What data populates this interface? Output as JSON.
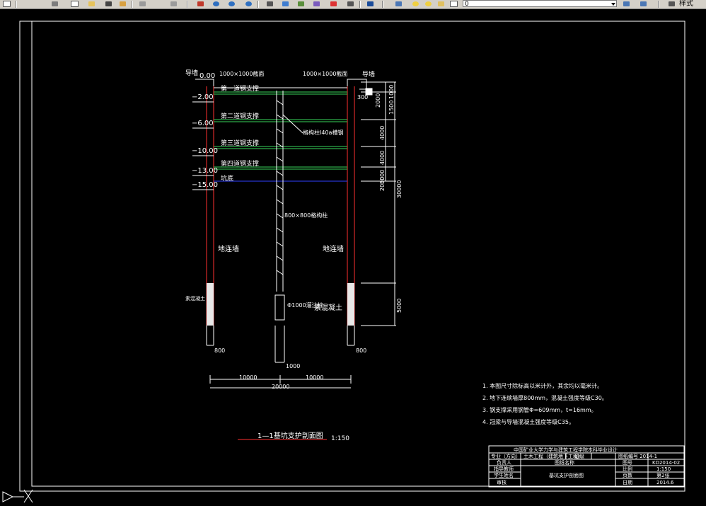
{
  "toolbar": {
    "layer_combo_value": "0",
    "style_label": "样式"
  },
  "drawing": {
    "elevations": [
      "0.00",
      "−2.00",
      "−6.00",
      "−10.00",
      "−13.00",
      "−15.00"
    ],
    "top_label_left": "导墙",
    "top_label_right": "导墙",
    "top_section_left": "1000×1000截面",
    "top_section_right": "1000×1000截面",
    "supports": [
      "第一道钢支撑",
      "第二道钢支撑",
      "第三道钢支撑",
      "第四道钢支撑"
    ],
    "bottom_label": "坑底",
    "column_beam_label": "格构柱I40a槽钢",
    "column_label": "800×800格构柱",
    "wall_left": "地连墙",
    "wall_right": "地连墙",
    "base_left": "素混凝土",
    "pile_label": "Φ1000灌注桩",
    "concrete_label": "素混凝土",
    "small_300": "300",
    "right_dims_top": [
      "1000",
      "2000",
      "1500",
      "4000",
      "4000",
      "3000",
      "2000"
    ],
    "right_dim_total": "30000",
    "right_dim_bottom": "5000",
    "bottom_dims": {
      "left_800": "800",
      "right_800": "800",
      "center_1000": "1000",
      "left_10000": "10000",
      "right_10000": "10000",
      "total": "20000"
    },
    "section_title": "1—1基坑支护剖面图",
    "section_scale": "1:150"
  },
  "notes": [
    "1. 本图尺寸除标高以米计外，其余均以毫米计。",
    "2. 地下连续墙厚800mm，混凝土强度等级C30。",
    "3. 钢支撑采用钢管Φ=609mm，t=16mm。",
    "4. 冠梁与导墙混凝土强度等级C35。"
  ],
  "title_block": {
    "header": "中国矿业大学力学与建筑工程学院本科毕业设计",
    "row1_left": "专业（方向）",
    "row1_mid": "土木工程（建筑地下工程）",
    "row1_c": "班级",
    "row1_right": "图纸编号 2014-1",
    "row2_a": "负责人",
    "row2_b": "图纸名称",
    "row2_c": "图号",
    "row2_d": "KD2014-02",
    "row3_a": "指导教师",
    "row3_b": "基坑支护剖面图",
    "row3_c": "比例",
    "row3_d": "1:150",
    "row4_a": "学生姓名",
    "row4_c": "页数",
    "row4_d": "第2张",
    "row5_a": "审核",
    "row5_c": "日期",
    "row5_d": "2014.6"
  }
}
